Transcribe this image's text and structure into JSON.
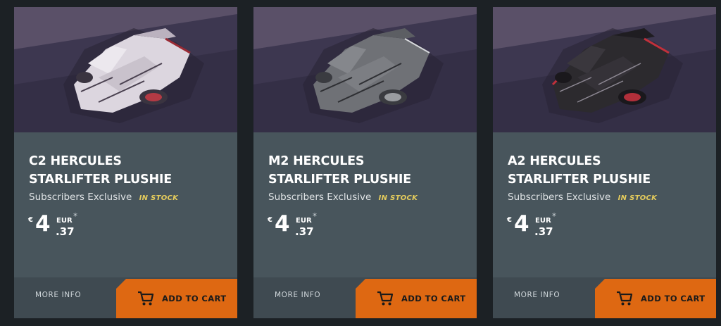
{
  "products": [
    {
      "name_line1": "C2 HERCULES",
      "name_line2": "STARLIFTER PLUSHIE",
      "subtitle": "Subscribers Exclusive",
      "stock": "IN STOCK",
      "currency_symbol": "€",
      "price_whole": "4",
      "currency_code": "EUR",
      "price_note_mark": "*",
      "price_cents": ".37",
      "more_info_label": "MORE INFO",
      "add_to_cart_label": "ADD TO CART",
      "image_icon": "white-starlifter-plushie",
      "body_color": "#dcd6df"
    },
    {
      "name_line1": "M2 HERCULES",
      "name_line2": "STARLIFTER PLUSHIE",
      "subtitle": "Subscribers Exclusive",
      "stock": "IN STOCK",
      "currency_symbol": "€",
      "price_whole": "4",
      "currency_code": "EUR",
      "price_note_mark": "*",
      "price_cents": ".37",
      "more_info_label": "MORE INFO",
      "add_to_cart_label": "ADD TO CART",
      "image_icon": "grey-starlifter-plushie",
      "body_color": "#6f7176"
    },
    {
      "name_line1": "A2 HERCULES",
      "name_line2": "STARLIFTER PLUSHIE",
      "subtitle": "Subscribers Exclusive",
      "stock": "IN STOCK",
      "currency_symbol": "€",
      "price_whole": "4",
      "currency_code": "EUR",
      "price_note_mark": "*",
      "price_cents": ".37",
      "more_info_label": "MORE INFO",
      "add_to_cart_label": "ADD TO CART",
      "image_icon": "black-starlifter-plushie",
      "body_color": "#2c2a2e"
    }
  ],
  "colors": {
    "page_background": "#1c2125",
    "card_background": "#48555c",
    "footer_background": "#3f4a51",
    "accent_orange": "#de6812",
    "stock_yellow": "#e5cc5c"
  }
}
